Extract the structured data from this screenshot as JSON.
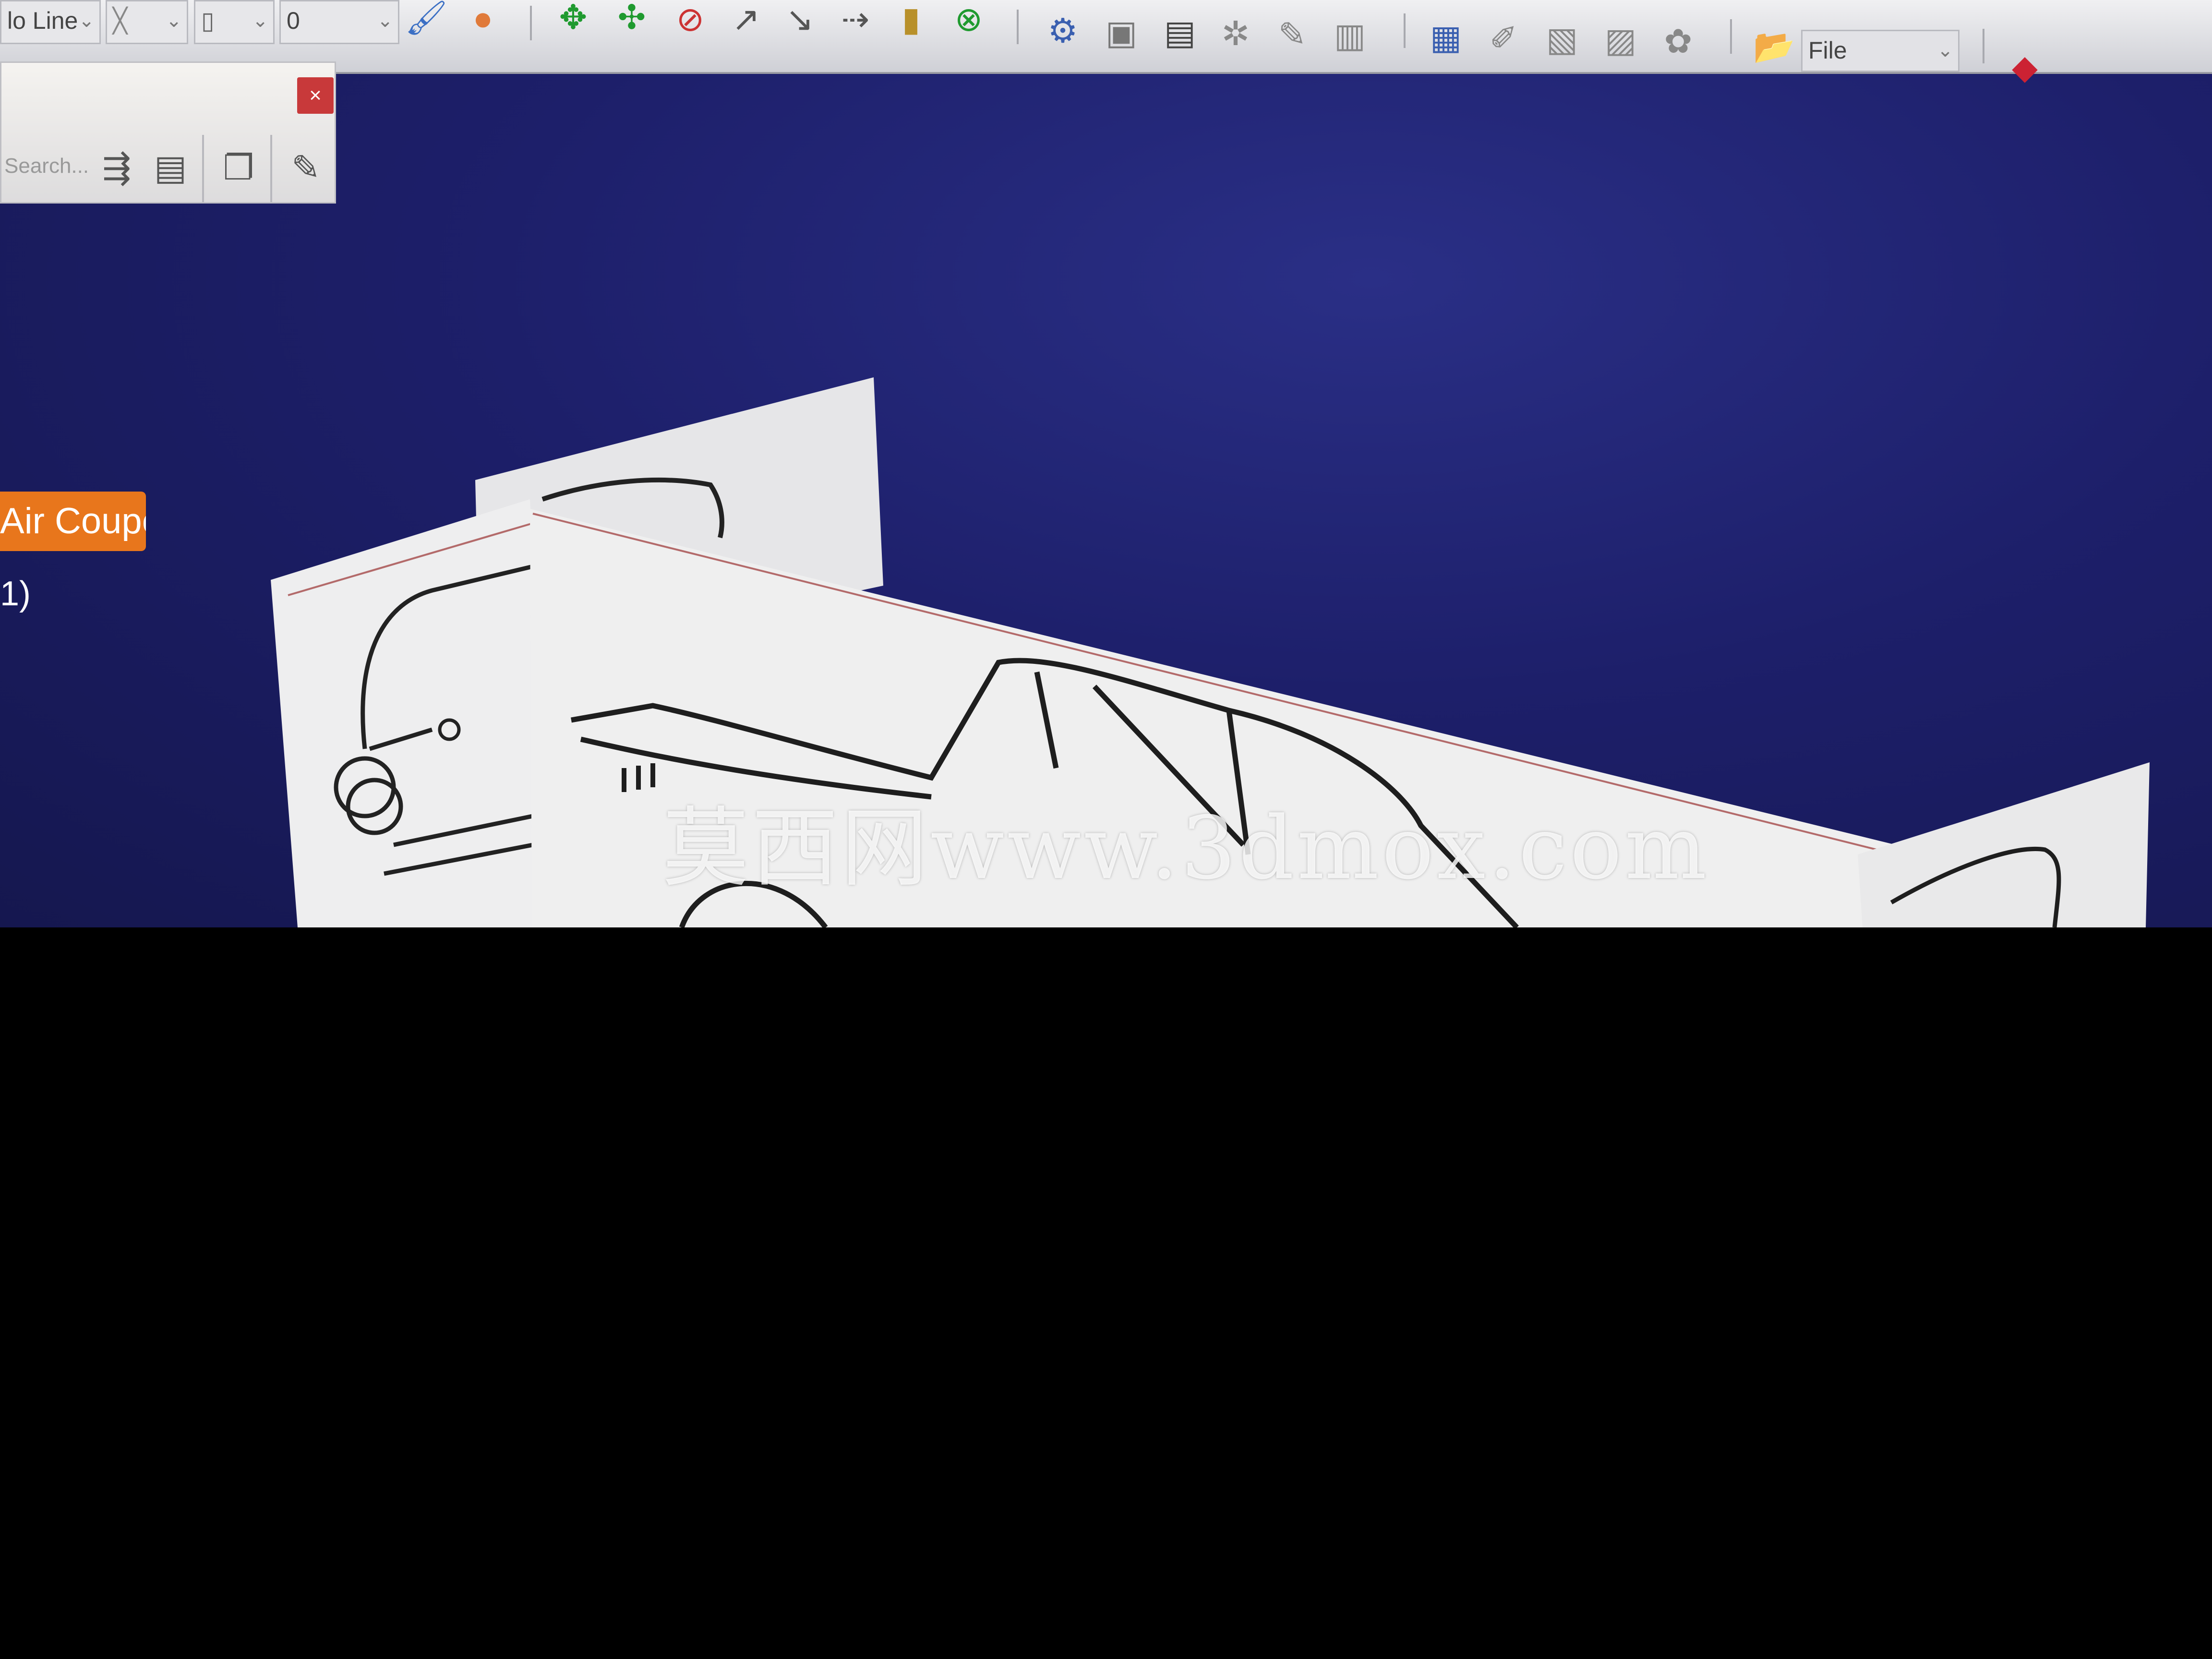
{
  "toolbar": {
    "line_style_value": "lo Line",
    "line_weight_value": "",
    "layer_value": "0",
    "file_combo_label": "File"
  },
  "panel": {
    "close_label": "×",
    "search_placeholder": "Search..."
  },
  "tree": {
    "selected_label": "Air Coupe",
    "item_2_label": "1)"
  },
  "viewport": {
    "watermark_text": "莫西网www.3dmox.com"
  },
  "colors": {
    "background_top": "#2a2f86",
    "background_bottom": "#15174f",
    "selection": "#e8761c",
    "close_button": "#c8393a"
  },
  "icons": [
    "painter-icon",
    "color-palette-icon",
    "pan-icon",
    "rotate-icon",
    "no-rotate-icon",
    "point-icon",
    "arrow-icon",
    "align-icon",
    "ruler-icon",
    "no-select-icon",
    "gear-icon",
    "clipboard-icon",
    "document-icon",
    "folder-icon",
    "box-icon"
  ]
}
